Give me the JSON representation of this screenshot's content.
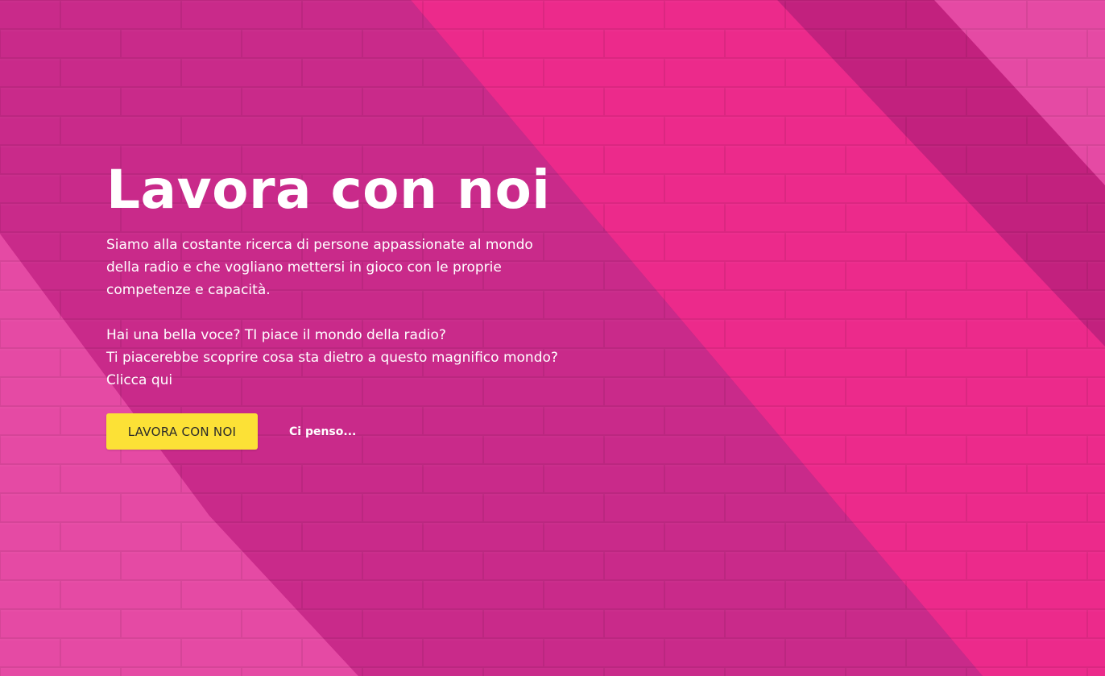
{
  "hero": {
    "title": "Lavora con noi",
    "paragraph_lines": [
      "Siamo alla costante ricerca di persone appassionate al mondo",
      "della radio e che vogliano mettersi in gioco con le proprie",
      "competenze e capacità."
    ],
    "question_lines": [
      "Hai una bella voce? TI piace il mondo della radio?",
      "Ti piacerebbe scoprire cosa sta dietro a questo magnifico mondo?",
      "Clicca qui"
    ],
    "primary_button_label": "LAVORA CON NOI",
    "secondary_link_label": "Ci penso..."
  },
  "colors": {
    "background_dark": "#c2217e",
    "background_bright": "#ec2a8b",
    "background_light": "#e54aa4",
    "button": "#fce136",
    "text": "#ffffff"
  }
}
